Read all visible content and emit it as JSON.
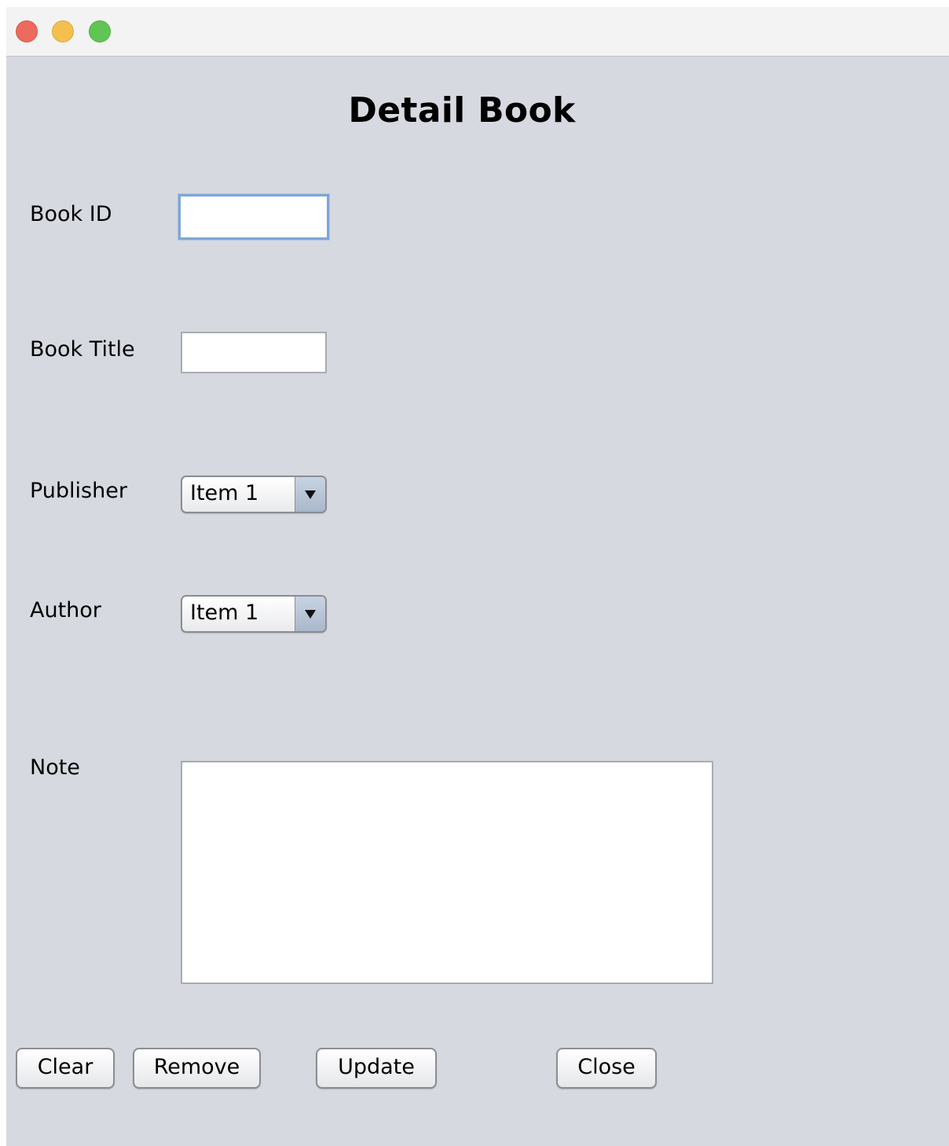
{
  "window": {
    "title": ""
  },
  "form": {
    "heading": "Detail Book",
    "book_id": {
      "label": "Book ID",
      "value": ""
    },
    "book_title": {
      "label": "Book Title",
      "value": ""
    },
    "publisher": {
      "label": "Publisher",
      "selected": "Item 1"
    },
    "author": {
      "label": "Author",
      "selected": "Item 1"
    },
    "note": {
      "label": "Note",
      "value": ""
    }
  },
  "buttons": {
    "clear": "Clear",
    "remove": "Remove",
    "update": "Update",
    "close": "Close"
  },
  "colors": {
    "window_background": "#d6d9e0",
    "titlebar": "#f3f3f3",
    "traffic_close": "#ec6b5e",
    "traffic_minimize": "#f4bf4f",
    "traffic_maximize": "#61c554",
    "focus_ring": "#7ea6d6"
  }
}
